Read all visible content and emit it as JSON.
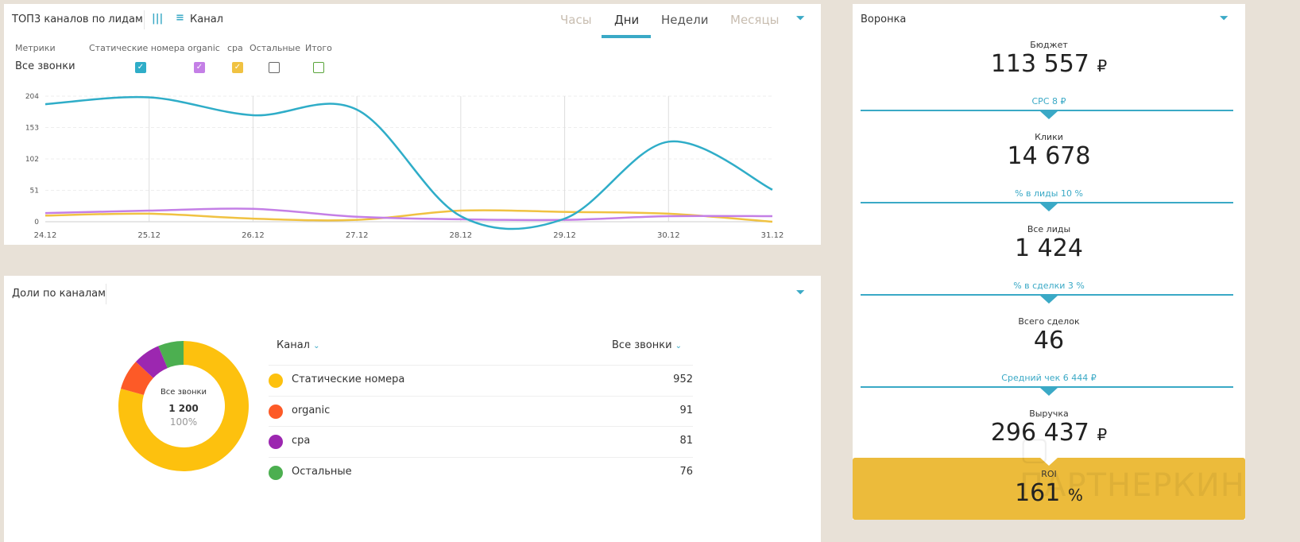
{
  "top_chart": {
    "title": "ТОП3 каналов по лидам",
    "group_label": "Канал",
    "tabs": [
      {
        "label": "Часы"
      },
      {
        "label": "Дни"
      },
      {
        "label": "Недели"
      },
      {
        "label": "Месяцы"
      }
    ],
    "metrics_header": "Метрики",
    "metric_row": "Все звонки",
    "columns": [
      {
        "label": "Статические номера",
        "checked": true,
        "color": "#2fadc8"
      },
      {
        "label": "organic",
        "checked": true,
        "color": "#c47fe6"
      },
      {
        "label": "cpa",
        "checked": true,
        "color": "#f0c242"
      },
      {
        "label": "Остальные",
        "checked": false,
        "color": "#666666"
      },
      {
        "label": "Итого",
        "checked": false,
        "color": "#5aa53b"
      }
    ]
  },
  "chart_data": [
    {
      "type": "line",
      "title": "ТОП3 каналов по лидам",
      "xlabel": "",
      "ylabel": "",
      "x": [
        "24.12",
        "25.12",
        "26.12",
        "27.12",
        "28.12",
        "29.12",
        "30.12",
        "31.12"
      ],
      "yticks": [
        "0",
        "51",
        "102",
        "153",
        "204"
      ],
      "ylim": [
        0,
        204
      ],
      "series": [
        {
          "name": "Статические номера",
          "color": "#2fadc8",
          "values": [
            191,
            202,
            173,
            182,
            9,
            5,
            130,
            52
          ]
        },
        {
          "name": "organic",
          "color": "#c47fe6",
          "values": [
            14,
            18,
            21,
            8,
            4,
            3,
            9,
            9
          ]
        },
        {
          "name": "cpa",
          "color": "#f0c242",
          "values": [
            10,
            13,
            5,
            3,
            18,
            16,
            13,
            0
          ]
        }
      ]
    },
    {
      "type": "pie",
      "title": "Доли по каналам",
      "center_label": "Все звонки",
      "center_total": "1 200",
      "center_percent": "100%",
      "categories": [
        "Статические номера",
        "organic",
        "cpa",
        "Остальные"
      ],
      "values": [
        952,
        91,
        81,
        76
      ],
      "colors": [
        "#fdc10e",
        "#fd5a27",
        "#9c27b0",
        "#4caf50"
      ]
    }
  ],
  "shares": {
    "title": "Доли по каналам",
    "col_channel": "Канал",
    "col_value": "Все звонки",
    "rows": [
      {
        "label": "Статические номера",
        "value": "952"
      },
      {
        "label": "organic",
        "value": "91"
      },
      {
        "label": "cpa",
        "value": "81"
      },
      {
        "label": "Остальные",
        "value": "76"
      }
    ]
  },
  "funnel": {
    "title": "Воронка",
    "stages": [
      {
        "label": "Бюджет",
        "value": "113 557",
        "unit": "₽"
      },
      {
        "label": "Клики",
        "value": "14 678",
        "unit": ""
      },
      {
        "label": "Все лиды",
        "value": "1 424",
        "unit": ""
      },
      {
        "label": "Всего сделок",
        "value": "46",
        "unit": ""
      },
      {
        "label": "Выручка",
        "value": "296 437",
        "unit": "₽"
      }
    ],
    "links": [
      "CPC 8 ₽",
      "% в лиды 10 %",
      "% в сделки 3 %",
      "Средний чек 6 444 ₽"
    ],
    "roi": {
      "label": "ROI",
      "value": "161",
      "unit": "%"
    }
  },
  "watermark": "ПАРТНЕРКИН"
}
